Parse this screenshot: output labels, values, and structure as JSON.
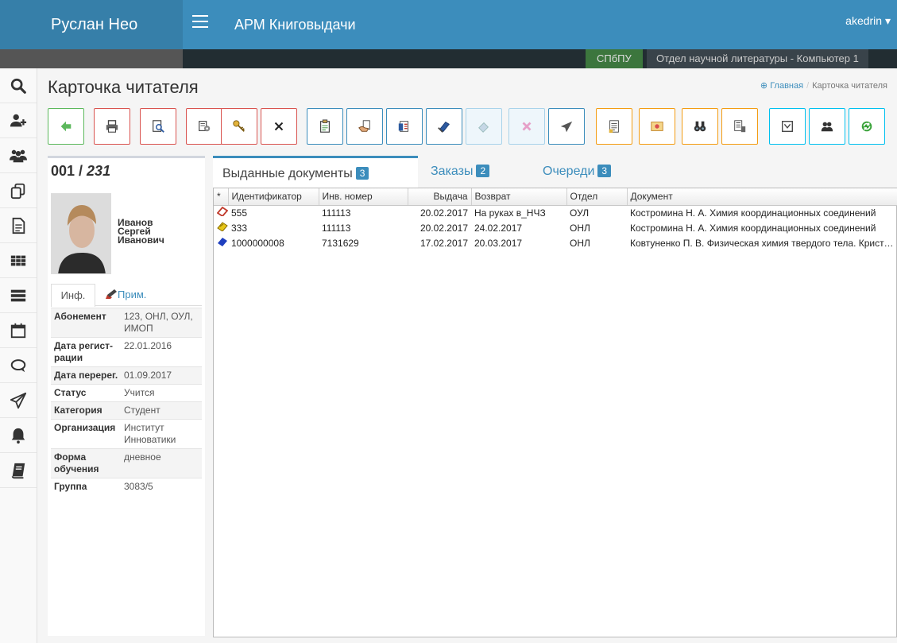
{
  "brand": "Руслан Нео",
  "app_title": "АРМ Книговыдачи",
  "user": "akedrin",
  "org": "СПбПУ",
  "department": "Отдел научной литературы - Компьютер 1",
  "page": {
    "title": "Карточка читателя",
    "breadcrumb_home": "Главная",
    "breadcrumb_current": "Карточка читателя"
  },
  "reader": {
    "id_prefix": "001 / ",
    "id_number": "231",
    "last_name": "Иванов",
    "first_name": "Сергей",
    "patronymic": "Иванович"
  },
  "left_tabs": {
    "info": "Инф.",
    "notes": "Прим."
  },
  "info": [
    {
      "label": "Абонемент",
      "value": "123, ОНЛ, ОУЛ, ИМОП"
    },
    {
      "label": "Дата регист-рации",
      "value": "22.01.2016"
    },
    {
      "label": "Дата перерег.",
      "value": "01.09.2017"
    },
    {
      "label": "Статус",
      "value": "Учится"
    },
    {
      "label": "Категория",
      "value": "Студент"
    },
    {
      "label": "Организация",
      "value": "Институт Инноватики"
    },
    {
      "label": "Форма обучения",
      "value": "дневное"
    },
    {
      "label": "Группа",
      "value": "3083/5"
    }
  ],
  "tabs": [
    {
      "label": "Выданные документы",
      "count": "3"
    },
    {
      "label": "Заказы",
      "count": "2"
    },
    {
      "label": "Очереди",
      "count": "3"
    }
  ],
  "grid": {
    "columns": [
      "*",
      "Идентификатор",
      "Инв. номер",
      "Выдача",
      "Возврат",
      "Отдел",
      "Документ"
    ],
    "rows": [
      {
        "status": "red",
        "id": "555",
        "inv": "111113",
        "issue": "20.02.2017",
        "return": "На руках в_НЧЗ",
        "dept": "ОУЛ",
        "doc": "Костромина Н. А. Химия координационных соединений"
      },
      {
        "status": "yellow",
        "id": "333",
        "inv": "111113",
        "issue": "20.02.2017",
        "return": "24.02.2017",
        "dept": "ОНЛ",
        "doc": "Костромина Н. А. Химия координационных соединений"
      },
      {
        "status": "blue",
        "id": "1000000008",
        "inv": "7131629",
        "issue": "17.02.2017",
        "return": "20.03.2017",
        "dept": "ОНЛ",
        "doc": "Ковтуненко П. В. Физическая химия твердого тела. Кристаллы с дефектами"
      }
    ]
  },
  "colors": {
    "header": "#3c8dbc",
    "brand_bg": "#367fa9",
    "org_bg": "#3c763d",
    "status_red": "#c0392b",
    "status_yellow": "#e6c619",
    "status_blue": "#1f3fbf"
  }
}
